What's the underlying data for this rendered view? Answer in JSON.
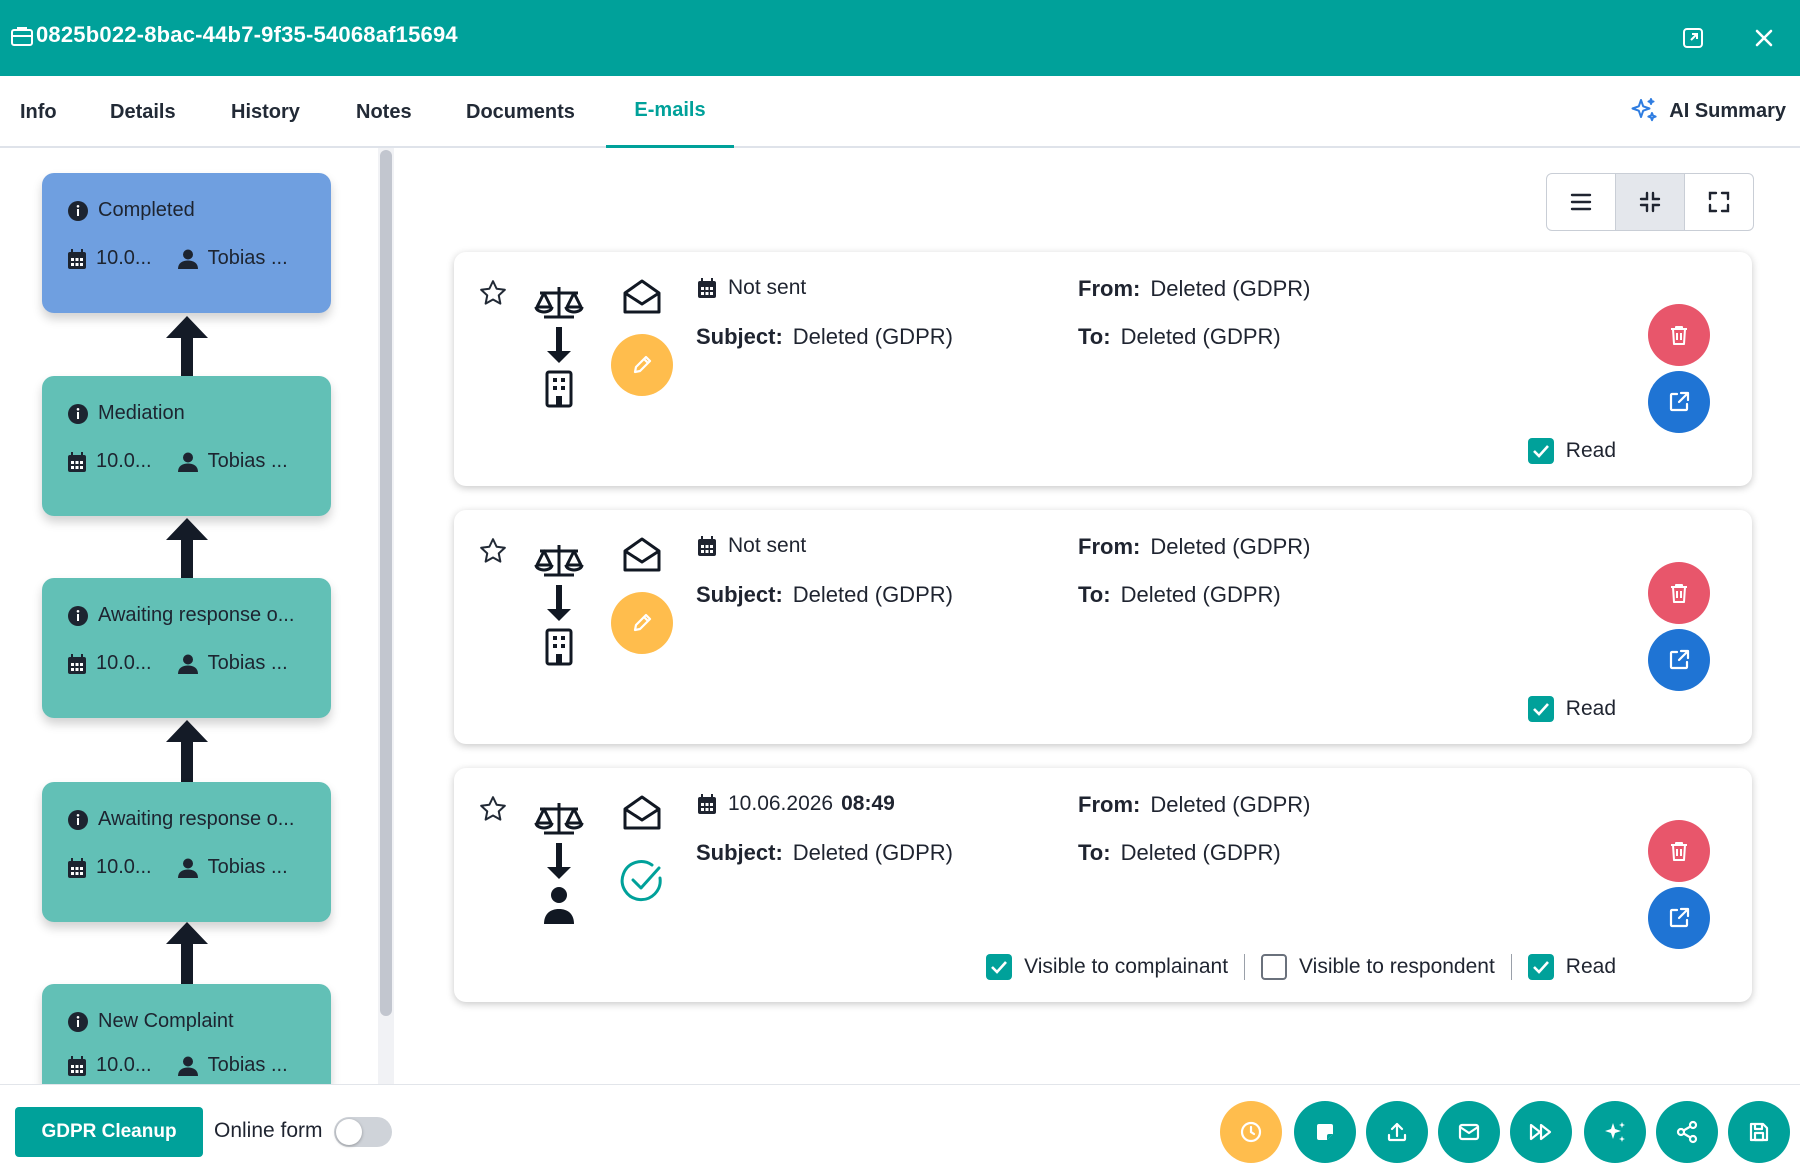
{
  "window": {
    "case_id": "0825b022-8bac-44b7-9f35-54068af15694",
    "icons": {
      "case": "briefcase-icon",
      "expand": "expand-window-icon",
      "close": "close-icon"
    }
  },
  "tabs": [
    {
      "label": "Info",
      "active": false
    },
    {
      "label": "Details",
      "active": false
    },
    {
      "label": "History",
      "active": false
    },
    {
      "label": "Notes",
      "active": false
    },
    {
      "label": "Documents",
      "active": false
    },
    {
      "label": "E-mails",
      "active": true
    }
  ],
  "ai_summary": {
    "label": "AI Summary",
    "icon": "sparkle-icon"
  },
  "timeline": [
    {
      "status": "Completed",
      "date": "10.0...",
      "user": "Tobias ...",
      "color": "#6f9fe0"
    },
    {
      "status": "Mediation",
      "date": "10.0...",
      "user": "Tobias ...",
      "color": "#62c0b6"
    },
    {
      "status": "Awaiting response o...",
      "date": "10.0...",
      "user": "Tobias ...",
      "color": "#62c0b6"
    },
    {
      "status": "Awaiting response o...",
      "date": "10.0...",
      "user": "Tobias ...",
      "color": "#62c0b6"
    },
    {
      "status": "New Complaint",
      "date": "10.0...",
      "user": "Tobias ...",
      "color": "#62c0b6"
    }
  ],
  "emails": [
    {
      "date": "Not sent",
      "time": "",
      "subject_label": "Subject:",
      "subject": "Deleted (GDPR)",
      "from_label": "From:",
      "from": "Deleted (GDPR)",
      "to_label": "To:",
      "to": "Deleted (GDPR)",
      "direction_to": "building-icon",
      "state": "draft",
      "checks": [
        {
          "label": "Read",
          "checked": true
        }
      ]
    },
    {
      "date": "Not sent",
      "time": "",
      "subject_label": "Subject:",
      "subject": "Deleted (GDPR)",
      "from_label": "From:",
      "from": "Deleted (GDPR)",
      "to_label": "To:",
      "to": "Deleted (GDPR)",
      "direction_to": "building-icon",
      "state": "draft",
      "checks": [
        {
          "label": "Read",
          "checked": true
        }
      ]
    },
    {
      "date": "10.06.2026",
      "time": "08:49",
      "subject_label": "Subject:",
      "subject": "Deleted (GDPR)",
      "from_label": "From:",
      "from": "Deleted (GDPR)",
      "to_label": "To:",
      "to": "Deleted (GDPR)",
      "direction_to": "person-icon",
      "state": "sent",
      "checks": [
        {
          "label": "Visible to complainant",
          "checked": true
        },
        {
          "label": "Visible to respondent",
          "checked": false
        },
        {
          "label": "Read",
          "checked": true
        }
      ]
    }
  ],
  "footer": {
    "gdpr_button": "GDPR Cleanup",
    "online_form_label": "Online form",
    "online_form_on": false,
    "actions": [
      "clock-icon",
      "note-icon",
      "upload-icon",
      "mail-icon",
      "fast-forward-icon",
      "sparkle-icon",
      "share-icon",
      "save-icon"
    ]
  },
  "colors": {
    "teal": "#00a19a",
    "orange": "#ffbd4d",
    "danger": "#e8566b",
    "primary": "#1f74d4"
  }
}
